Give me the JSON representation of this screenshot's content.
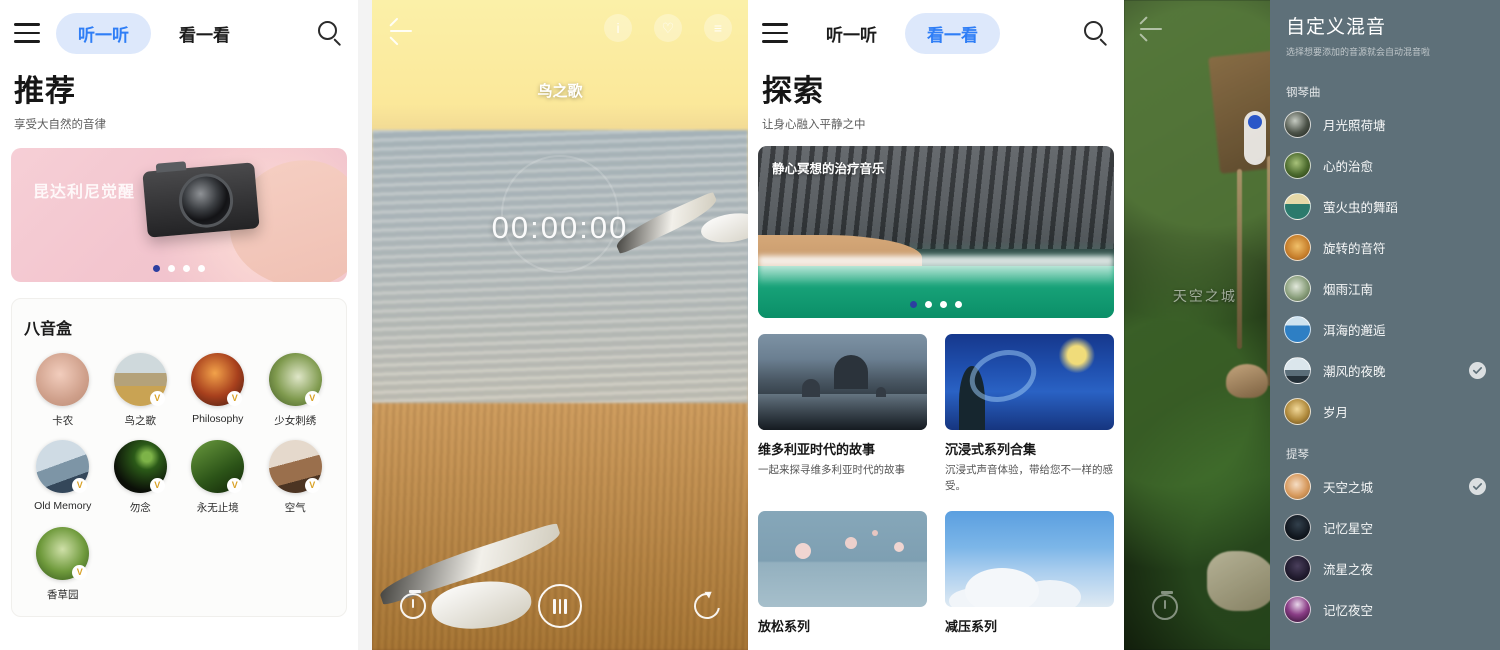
{
  "panel1": {
    "nav": {
      "menu_icon": "hamburger-icon",
      "search_icon": "search-icon",
      "tabs": [
        {
          "label": "听一听",
          "active": true
        },
        {
          "label": "看一看",
          "active": false
        }
      ]
    },
    "title": "推荐",
    "subtitle": "享受大自然的音律",
    "banner": {
      "label": "昆达利尼觉醒",
      "dots": 4,
      "active_dot": 0
    },
    "section": {
      "title": "八音盒",
      "items": [
        {
          "label": "卡农",
          "vip": false
        },
        {
          "label": "鸟之歌",
          "vip": true
        },
        {
          "label": "Philosophy",
          "vip": true
        },
        {
          "label": "少女刺绣",
          "vip": true
        },
        {
          "label": "Old Memory",
          "vip": true
        },
        {
          "label": "勿念",
          "vip": true
        },
        {
          "label": "永无止境",
          "vip": true
        },
        {
          "label": "空气",
          "vip": true
        },
        {
          "label": "香草园",
          "vip": true
        }
      ],
      "vip_badge": "V"
    }
  },
  "panel2": {
    "back_icon": "back-arrow-icon",
    "actions": [
      {
        "name": "info-icon",
        "glyph": "i"
      },
      {
        "name": "favorite-icon",
        "glyph": "♡"
      },
      {
        "name": "more-icon",
        "glyph": "≡"
      }
    ],
    "track_title": "鸟之歌",
    "elapsed_time": "00:00:00",
    "controls": [
      {
        "name": "sleep-timer-button",
        "label": "timer"
      },
      {
        "name": "pause-button",
        "label": "pause"
      },
      {
        "name": "loop-button",
        "label": "loop"
      }
    ]
  },
  "panel3": {
    "nav": {
      "menu_icon": "hamburger-icon",
      "search_icon": "search-icon",
      "tabs": [
        {
          "label": "听一听",
          "active": false
        },
        {
          "label": "看一看",
          "active": true
        }
      ]
    },
    "title": "探索",
    "subtitle": "让身心融入平静之中",
    "hero": {
      "label": "静心冥想的治疗音乐",
      "dots": 4,
      "active_dot": 0
    },
    "cards": [
      {
        "title": "维多利亚时代的故事",
        "desc": "一起来探寻维多利亚时代的故事"
      },
      {
        "title": "沉浸式系列合集",
        "desc": "沉浸式声音体验，带给您不一样的感受。"
      },
      {
        "title": "放松系列",
        "desc": ""
      },
      {
        "title": "减压系列",
        "desc": ""
      }
    ]
  },
  "panel4": {
    "back_icon": "back-arrow-icon",
    "bg_track_label": "天空之城",
    "timer_icon": "sleep-timer-icon",
    "title": "自定义混音",
    "subtitle": "选择想要添加的音源就会自动混音啦",
    "groups": [
      {
        "name": "钢琴曲",
        "items": [
          {
            "label": "月光照荷塘",
            "selected": false
          },
          {
            "label": "心的治愈",
            "selected": false
          },
          {
            "label": "萤火虫的舞蹈",
            "selected": false
          },
          {
            "label": "旋转的音符",
            "selected": false
          },
          {
            "label": "烟雨江南",
            "selected": false
          },
          {
            "label": "洱海的邂逅",
            "selected": false
          },
          {
            "label": "潮风的夜晚",
            "selected": true
          },
          {
            "label": "岁月",
            "selected": false
          }
        ]
      },
      {
        "name": "提琴",
        "items": [
          {
            "label": "天空之城",
            "selected": true
          },
          {
            "label": "记忆星空",
            "selected": false
          },
          {
            "label": "流星之夜",
            "selected": false
          },
          {
            "label": "记忆夜空",
            "selected": false
          }
        ]
      }
    ]
  },
  "colors": {
    "accent_blue": "#2f7ef6",
    "tab_pill_bg": "#dde8fb",
    "dot_active": "#2c3fa0",
    "vip_gold": "#d9a227",
    "sheet_bg": "#5e7079"
  }
}
